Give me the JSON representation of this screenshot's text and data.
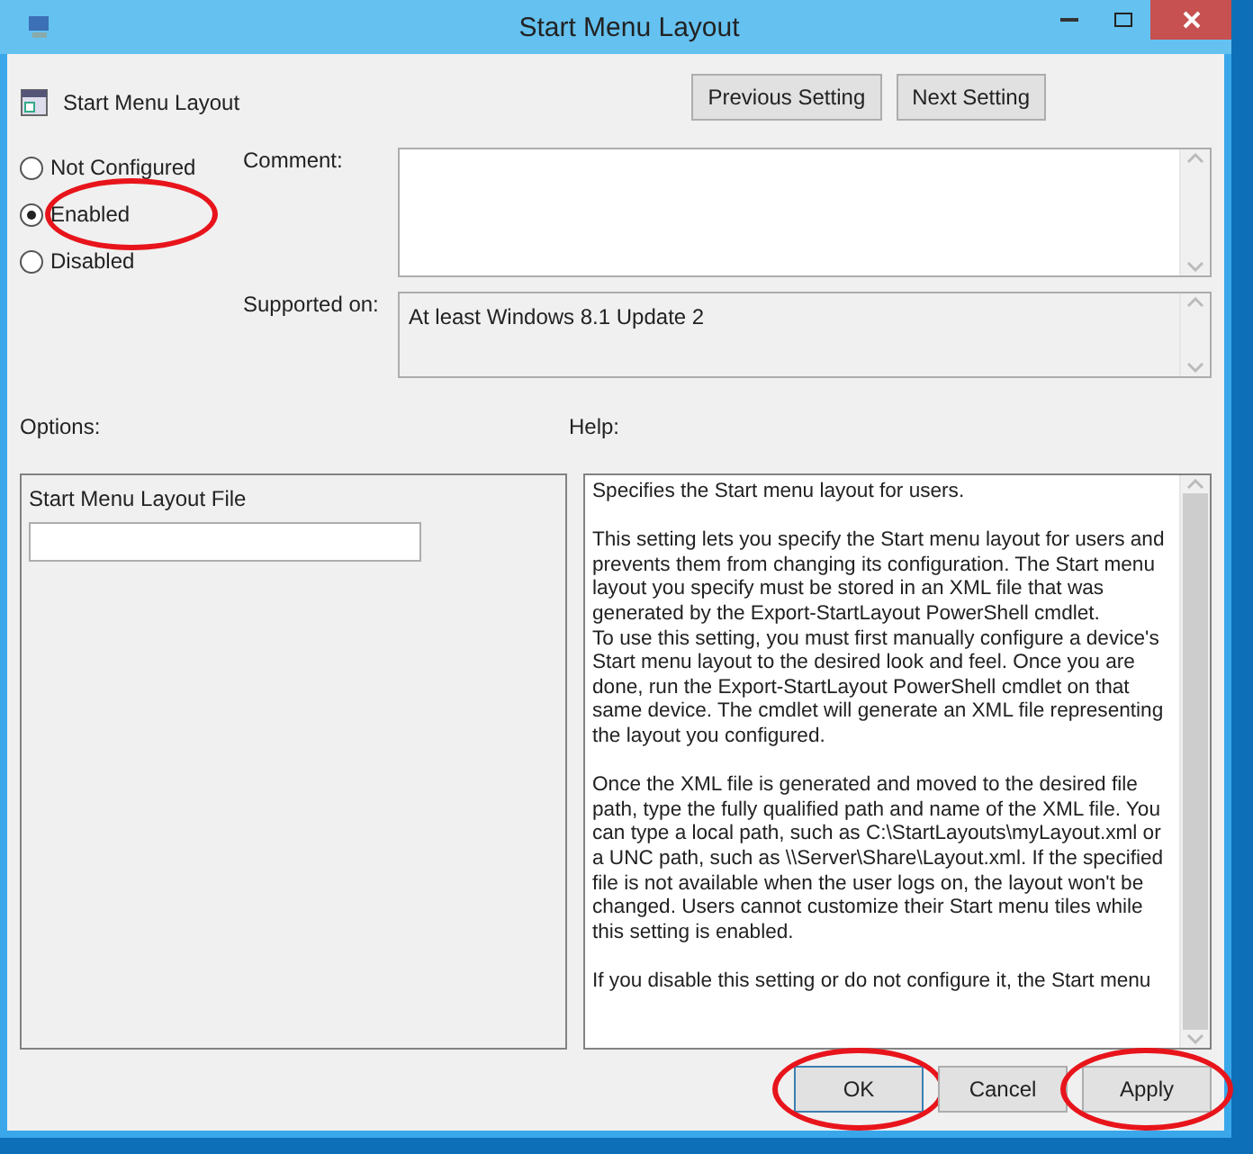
{
  "window": {
    "title": "Start Menu Layout"
  },
  "policy": {
    "name": "Start Menu Layout"
  },
  "nav_buttons": [
    {
      "label": "Previous Setting"
    },
    {
      "label": "Next Setting"
    }
  ],
  "radios": [
    {
      "label": "Not Configured",
      "selected": false,
      "circled": false
    },
    {
      "label": "Enabled",
      "selected": true,
      "circled": true
    },
    {
      "label": "Disabled",
      "selected": false,
      "circled": false
    }
  ],
  "comment": {
    "label": "Comment:"
  },
  "supported_on": {
    "label": "Supported on:",
    "value": "At least Windows 8.1 Update 2"
  },
  "options": {
    "label": "Options:",
    "field_label": "Start Menu Layout File"
  },
  "help": {
    "label": "Help:",
    "paragraphs": [
      "Specifies the Start menu layout for users.",
      "This setting lets you specify the Start menu layout for users and prevents them from changing its configuration. The Start menu layout you specify must be stored in an XML file that was generated by the Export-StartLayout PowerShell cmdlet.\nTo use this setting, you must first manually configure a device's Start menu layout to the desired look and feel. Once you are done, run the Export-StartLayout PowerShell cmdlet on that same device. The cmdlet will generate an XML file representing the layout you configured.",
      "Once the XML file is generated and moved to the desired file path, type the fully qualified path and name of the XML file. You can type a local path, such as C:\\StartLayouts\\myLayout.xml or a UNC path, such as \\\\Server\\Share\\Layout.xml. If the specified file is not available when the user logs on, the layout won't be changed. Users cannot customize their Start menu tiles while this setting is enabled.",
      "If you disable this setting or do not configure it, the Start menu"
    ]
  },
  "buttons": [
    {
      "label": "OK",
      "default": true,
      "circled": true
    },
    {
      "label": "Cancel",
      "default": false,
      "circled": false
    },
    {
      "label": "Apply",
      "default": false,
      "circled": true
    }
  ]
}
